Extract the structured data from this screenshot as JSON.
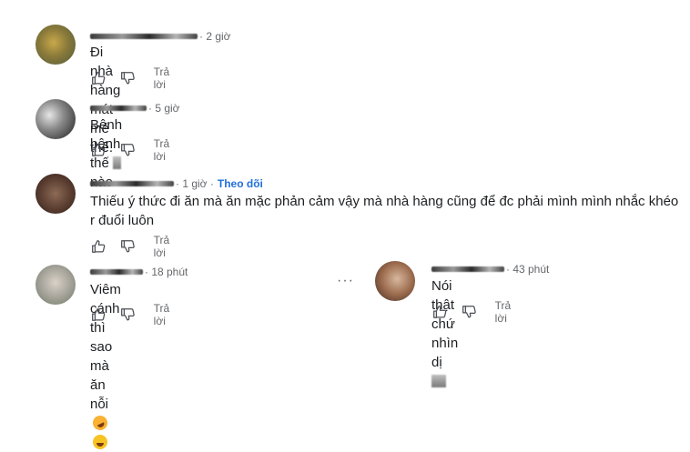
{
  "ui": {
    "reply_label": "Trả lời",
    "like_icon": "thumbs-up-icon",
    "dislike_icon": "thumbs-down-icon",
    "more_label": "···"
  },
  "comments": [
    {
      "time": "· 2 giờ",
      "text": "Đi nhà hàng mát mẻ thế."
    },
    {
      "time": "· 5 giờ",
      "text_before": "Bệnh bệnh thế",
      "text_after": "nào"
    },
    {
      "time": "· 1 giờ ·",
      "follow": "Theo dõi",
      "text": "Thiếu ý thức đi ăn mà ăn mặc phản cảm vậy mà nhà hàng cũng để đc phải mình mình nhắc khéo r đuổi luôn"
    },
    {
      "time": "· 18 phút",
      "text": "Viêm cánh thì sao mà ăn nỗi"
    },
    {
      "time": "· 43 phút",
      "text": "Nói thật chứ nhìn dị"
    }
  ]
}
